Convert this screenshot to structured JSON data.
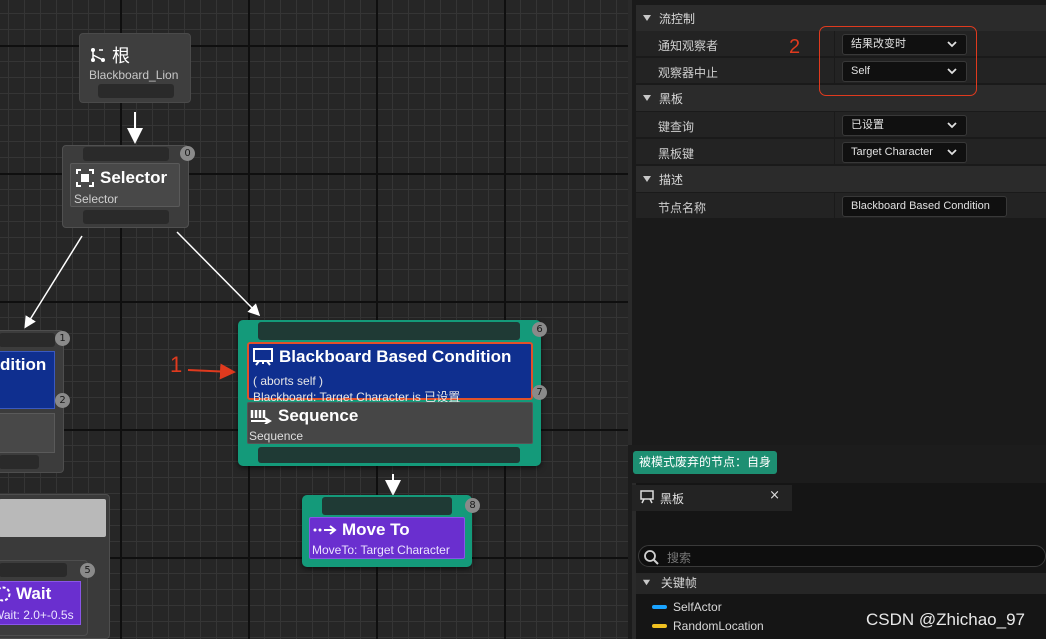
{
  "colors": {
    "accent_teal": "#149a7a",
    "decorator_blue": "#0f2f8f",
    "task_purple": "#6a2fcf",
    "highlight_red": "#e03a1e"
  },
  "graph": {
    "root": {
      "icon": "tree-root-icon",
      "title": "根",
      "subtitle": "Blackboard_Lion"
    },
    "selector": {
      "icon": "selector-icon",
      "title": "Selector",
      "subtitle": "Selector",
      "index": "0"
    },
    "left_node": {
      "title_partial": "dition",
      "index_top": "1",
      "index_mid": "2"
    },
    "sequence_group": {
      "decorator": {
        "icon": "blackboard-icon",
        "title": "Blackboard Based Condition",
        "line1": "( aborts self )",
        "line2": "Blackboard: Target Character is 已设置",
        "index": "7"
      },
      "sequence": {
        "icon": "sequence-icon",
        "title": "Sequence",
        "subtitle": "Sequence"
      },
      "index": "6"
    },
    "move_to": {
      "icon": "move-to-icon",
      "title": "Move To",
      "subtitle": "MoveTo: Target Character",
      "index": "8"
    },
    "wait": {
      "icon": "wait-icon",
      "title": "Wait",
      "subtitle": "Wait: 2.0+-0.5s",
      "index": "5"
    },
    "markers": {
      "m1": "1",
      "m2": "2"
    }
  },
  "details": {
    "categories": [
      {
        "label": "流控制",
        "props": [
          {
            "label": "通知观察者",
            "value": "结果改变时",
            "type": "dropdown"
          },
          {
            "label": "观察器中止",
            "value": "Self",
            "type": "dropdown"
          }
        ]
      },
      {
        "label": "黑板",
        "props": [
          {
            "label": "键查询",
            "value": "已设置",
            "type": "dropdown"
          },
          {
            "label": "黑板键",
            "value": "Target Character",
            "type": "dropdown"
          }
        ]
      },
      {
        "label": "描述",
        "props": [
          {
            "label": "节点名称",
            "value": "Blackboard Based Condition",
            "type": "text"
          }
        ]
      }
    ]
  },
  "abort_badge": "被模式废弃的节点：自身",
  "blackboard_panel": {
    "tab_label": "黑板",
    "close_label": "×",
    "search_placeholder": "搜索",
    "keys_header": "关键帧",
    "keys": [
      {
        "name": "SelfActor",
        "color": "#1aa3ff"
      },
      {
        "name": "RandomLocation",
        "color": "#f0c020"
      }
    ]
  },
  "watermark": "CSDN @Zhichao_97"
}
